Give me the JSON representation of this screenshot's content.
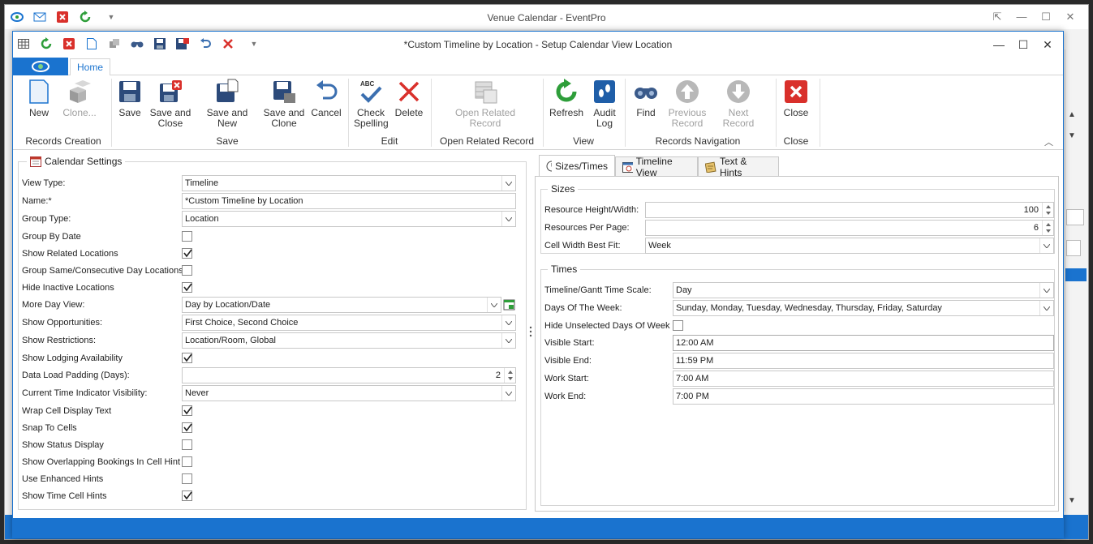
{
  "outer": {
    "title": "Venue Calendar - EventPro"
  },
  "dialog": {
    "title": "*Custom Timeline by Location - Setup Calendar View Location"
  },
  "ribbon": {
    "tab_home": "Home",
    "buttons": {
      "new": "New",
      "clone": "Clone...",
      "save": "Save",
      "save_close": "Save and Close",
      "save_new": "Save and New",
      "save_clone": "Save and Clone",
      "cancel": "Cancel",
      "check_spelling": "Check Spelling",
      "delete": "Delete",
      "open_related": "Open Related Record",
      "refresh": "Refresh",
      "audit_log": "Audit Log",
      "find": "Find",
      "previous": "Previous Record",
      "next": "Next Record",
      "close": "Close"
    },
    "groups": {
      "records_creation": "Records Creation",
      "save": "Save",
      "edit": "Edit",
      "open_related": "Open Related Record",
      "view": "View",
      "records_navigation": "Records Navigation",
      "close": "Close"
    }
  },
  "calendar_settings": {
    "legend": "Calendar Settings",
    "view_type": {
      "label": "View Type:",
      "value": "Timeline"
    },
    "name": {
      "label": "Name:*",
      "value": "*Custom Timeline by Location"
    },
    "group_type": {
      "label": "Group Type:",
      "value": "Location"
    },
    "group_by_date": {
      "label": "Group By Date",
      "checked": false
    },
    "show_related_locations": {
      "label": "Show Related Locations",
      "checked": true
    },
    "group_same_day": {
      "label": "Group Same/Consecutive Day Locations",
      "checked": false
    },
    "hide_inactive": {
      "label": "Hide Inactive Locations",
      "checked": true
    },
    "more_day_view": {
      "label": "More Day View:",
      "value": "Day by Location/Date"
    },
    "show_opportunities": {
      "label": "Show Opportunities:",
      "value": "First Choice, Second Choice"
    },
    "show_restrictions": {
      "label": "Show Restrictions:",
      "value": "Location/Room, Global"
    },
    "show_lodging": {
      "label": "Show Lodging Availability",
      "checked": true
    },
    "data_load_padding": {
      "label": "Data Load Padding (Days):",
      "value": "2"
    },
    "time_indicator": {
      "label": "Current Time Indicator Visibility:",
      "value": "Never"
    },
    "wrap_cell": {
      "label": "Wrap Cell Display Text",
      "checked": true
    },
    "snap_cells": {
      "label": "Snap To Cells",
      "checked": true
    },
    "show_status": {
      "label": "Show Status Display",
      "checked": false
    },
    "show_overlapping": {
      "label": "Show Overlapping Bookings In Cell Hint",
      "checked": false
    },
    "enhanced_hints": {
      "label": "Use Enhanced Hints",
      "checked": false
    },
    "time_cell_hints": {
      "label": "Show Time Cell Hints",
      "checked": true
    }
  },
  "right_tabs": {
    "sizes_times": "Sizes/Times",
    "timeline_view": "Timeline View",
    "text_hints": "Text & Hints"
  },
  "sizes": {
    "legend": "Sizes",
    "resource_height": {
      "label": "Resource Height/Width:",
      "value": "100"
    },
    "resources_per_page": {
      "label": "Resources Per Page:",
      "value": "6"
    },
    "cell_width": {
      "label": "Cell Width Best Fit:",
      "value": "Week"
    }
  },
  "times": {
    "legend": "Times",
    "time_scale": {
      "label": "Timeline/Gantt Time Scale:",
      "value": "Day"
    },
    "days_of_week": {
      "label": "Days Of The Week:",
      "value": "Sunday, Monday, Tuesday, Wednesday, Thursday, Friday, Saturday"
    },
    "hide_unselected": {
      "label": "Hide Unselected Days Of Week",
      "checked": false
    },
    "visible_start": {
      "label": "Visible Start:",
      "value": "12:00 AM"
    },
    "visible_end": {
      "label": "Visible End:",
      "value": "11:59 PM"
    },
    "work_start": {
      "label": "Work Start:",
      "value": "7:00 AM"
    },
    "work_end": {
      "label": "Work End:",
      "value": "7:00 PM"
    }
  },
  "colors": {
    "accent": "#1a73cf",
    "close_red": "#d9302b",
    "refresh_green": "#2e9e3a"
  }
}
